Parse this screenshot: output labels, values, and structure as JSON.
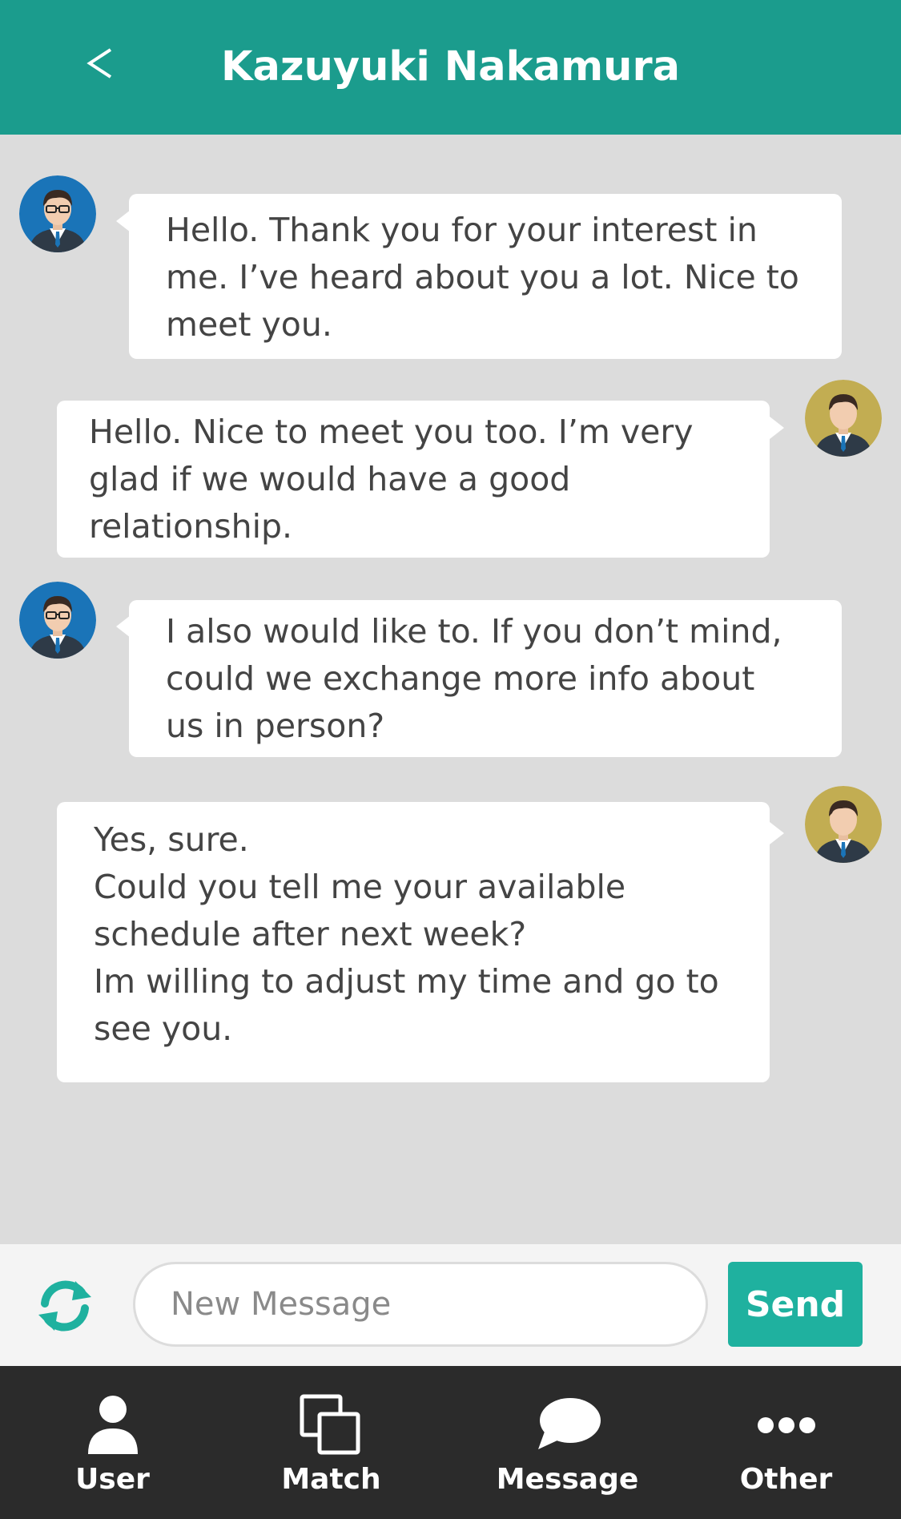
{
  "header": {
    "title": "Kazuyuki Nakamura",
    "back_icon": "chevron-left-icon"
  },
  "messages": [
    {
      "sender": "other",
      "text": "Hello. Thank you for your interest in\nme. I’ve heard about you a lot. Nice to\nmeet you."
    },
    {
      "sender": "me",
      "text": "Hello. Nice to meet you too. I’m very\nglad if we would have a good\nrelationship."
    },
    {
      "sender": "other",
      "text": "I also would like to. If you don’t mind,\ncould we exchange more info about\nus in person?"
    },
    {
      "sender": "me",
      "text": "Yes, sure.\nCould you tell me your available\nschedule after next week?\nIm willing to adjust my time and go to\nsee you."
    }
  ],
  "composer": {
    "placeholder": "New Message",
    "value": "",
    "send_label": "Send",
    "refresh_icon": "refresh-icon"
  },
  "tabbar": {
    "tabs": [
      {
        "label": "User",
        "icon": "user-icon"
      },
      {
        "label": "Match",
        "icon": "match-icon"
      },
      {
        "label": "Message",
        "icon": "message-icon"
      },
      {
        "label": "Other",
        "icon": "more-icon"
      }
    ]
  },
  "colors": {
    "brand": "#1b9c8d",
    "send": "#1fb19f",
    "tabbar": "#2b2b2b",
    "chat_bg": "#dcdcdc",
    "avatar_other_bg": "#1a74b8",
    "avatar_me_bg": "#c2ad52"
  }
}
